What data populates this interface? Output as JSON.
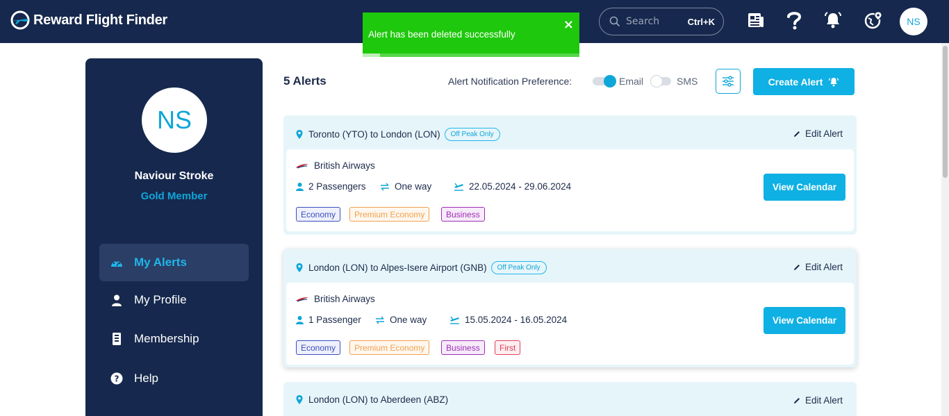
{
  "header": {
    "brand": "Reward Flight Finder",
    "search_placeholder": "Search",
    "search_shortcut": "Ctrl+K",
    "user_initials": "NS",
    "icons": [
      "news-icon",
      "help-icon",
      "bell-icon",
      "globe-pin-icon"
    ]
  },
  "toast": {
    "message": "Alert has been deleted successfully",
    "close": "×",
    "progress_fraction": 0.08,
    "color": "#1ec80c"
  },
  "sidebar": {
    "initials": "NS",
    "name": "Naviour Stroke",
    "tier": "Gold Member",
    "items": [
      {
        "label": "My Alerts",
        "icon": "dashboard-icon",
        "active": true
      },
      {
        "label": "My Profile",
        "icon": "user-icon",
        "active": false
      },
      {
        "label": "Membership",
        "icon": "card-icon",
        "active": false
      },
      {
        "label": "Help",
        "icon": "question-icon",
        "active": false
      }
    ]
  },
  "main": {
    "alerts_count": "5 Alerts",
    "pref_label": "Alert Notification Preference:",
    "email_label": "Email",
    "email_on": true,
    "sms_label": "SMS",
    "sms_on": false,
    "create_label": "Create Alert"
  },
  "cards": [
    {
      "route": "Toronto (YTO) to London (LON)",
      "badge": "Off Peak Only",
      "edit": "Edit Alert",
      "airline": "British Airways",
      "passengers": "2 Passengers",
      "trip": "One way",
      "dates": "22.05.2024 - 29.06.2024",
      "cabins": [
        "Economy",
        "Premium Economy",
        "Business"
      ],
      "view": "View Calendar"
    },
    {
      "route": "London (LON) to Alpes-Isere Airport (GNB)",
      "badge": "Off Peak Only",
      "edit": "Edit Alert",
      "airline": "British Airways",
      "passengers": "1 Passenger",
      "trip": "One way",
      "dates": "15.05.2024 - 16.05.2024",
      "cabins": [
        "Economy",
        "Premium Economy",
        "Business",
        "First"
      ],
      "view": "View Calendar"
    },
    {
      "route": "London (LON) to Aberdeen (ABZ)",
      "edit": "Edit Alert"
    }
  ],
  "colors": {
    "navy": "#16284d",
    "accent": "#0fb0e3",
    "economy": "#3b4fbf",
    "premium_economy": "#f0a050",
    "business": "#9b2fb5",
    "first": "#e0405a"
  }
}
